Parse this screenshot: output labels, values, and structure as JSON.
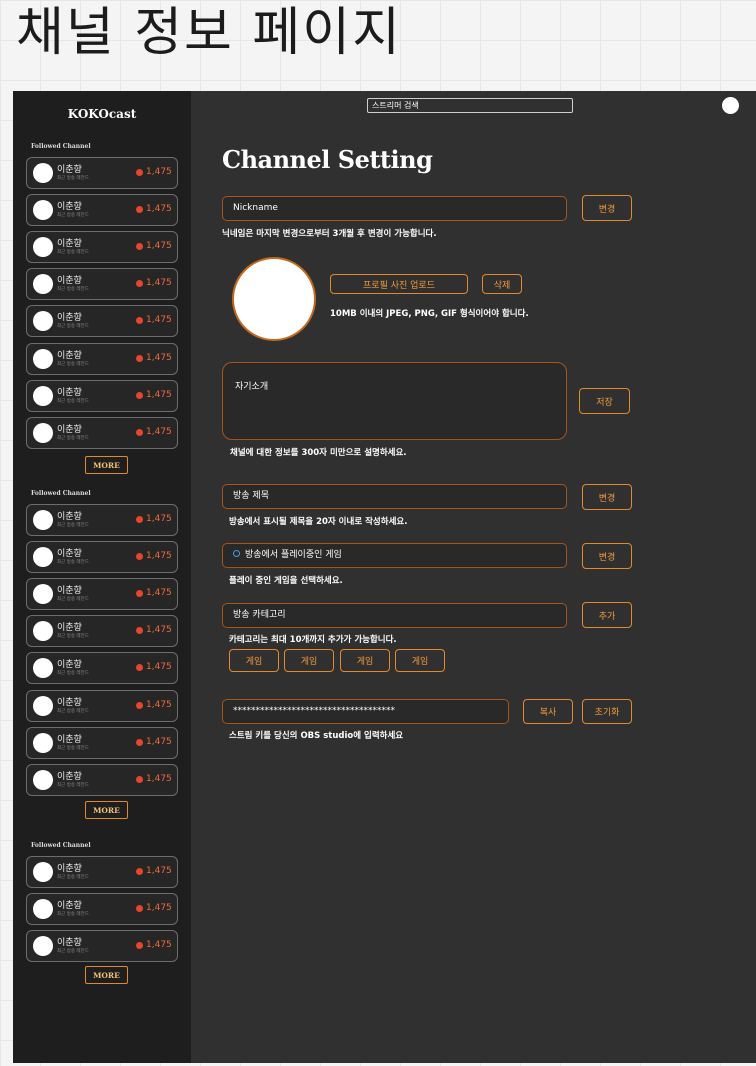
{
  "page_heading": "채널 정보 페이지",
  "sidebar": {
    "logo": "KOKOcast",
    "sections": [
      {
        "title": "Followed Channel",
        "channels": [
          {
            "name": "이춘향",
            "sub": "최근 방송 레전드",
            "viewers": "1,475"
          },
          {
            "name": "이춘향",
            "sub": "최근 방송 레전드",
            "viewers": "1,475"
          },
          {
            "name": "이춘향",
            "sub": "최근 방송 레전드",
            "viewers": "1,475"
          },
          {
            "name": "이춘향",
            "sub": "최근 방송 레전드",
            "viewers": "1,475"
          },
          {
            "name": "이춘향",
            "sub": "최근 방송 레전드",
            "viewers": "1,475"
          },
          {
            "name": "이춘향",
            "sub": "최근 방송 레전드",
            "viewers": "1,475"
          },
          {
            "name": "이춘향",
            "sub": "최근 방송 레전드",
            "viewers": "1,475"
          },
          {
            "name": "이춘향",
            "sub": "최근 방송 레전드",
            "viewers": "1,475"
          }
        ],
        "more_label": "MORE"
      },
      {
        "title": "Followed Channel",
        "channels": [
          {
            "name": "이춘향",
            "sub": "최근 방송 레전드",
            "viewers": "1,475"
          },
          {
            "name": "이춘향",
            "sub": "최근 방송 레전드",
            "viewers": "1,475"
          },
          {
            "name": "이춘향",
            "sub": "최근 방송 레전드",
            "viewers": "1,475"
          },
          {
            "name": "이춘향",
            "sub": "최근 방송 레전드",
            "viewers": "1,475"
          },
          {
            "name": "이춘향",
            "sub": "최근 방송 레전드",
            "viewers": "1,475"
          },
          {
            "name": "이춘향",
            "sub": "최근 방송 레전드",
            "viewers": "1,475"
          },
          {
            "name": "이춘향",
            "sub": "최근 방송 레전드",
            "viewers": "1,475"
          },
          {
            "name": "이춘향",
            "sub": "최근 방송 레전드",
            "viewers": "1,475"
          }
        ],
        "more_label": "MORE"
      },
      {
        "title": "Followed Channel",
        "channels": [
          {
            "name": "이춘향",
            "sub": "최근 방송 레전드",
            "viewers": "1,475"
          },
          {
            "name": "이춘향",
            "sub": "최근 방송 레전드",
            "viewers": "1,475"
          },
          {
            "name": "이춘향",
            "sub": "최근 방송 레전드",
            "viewers": "1,475"
          }
        ],
        "more_label": "MORE"
      }
    ]
  },
  "header": {
    "search_placeholder": "스트리머 검색"
  },
  "main": {
    "title": "Channel Setting",
    "nickname": {
      "value": "Nickname",
      "button": "변경",
      "help": "닉네임은 마지막 변경으로부터 3개월 후 변경이 가능합니다."
    },
    "profile": {
      "upload_button": "프로필 사진 업로드",
      "delete_button": "삭제",
      "help": "10MB 이내의 JPEG, PNG, GIF 형식이어야 합니다."
    },
    "intro": {
      "placeholder": "자기소개",
      "button": "저장",
      "help": "채널에 대한 정보를 300자 미만으로 설명하세요."
    },
    "stream_title": {
      "value": "방송 제목",
      "button": "변경",
      "help": "방송에서 표시될 제목을 20자 이내로 작성하세요."
    },
    "game": {
      "value": "방송에서 플레이중인 게임",
      "button": "변경",
      "help": "플레이 중인 게임을 선택하세요."
    },
    "category": {
      "value": "방송 카테고리",
      "button": "추가",
      "help": "카테고리는 최대 10개까지 추가가 가능합니다.",
      "tags": [
        "게임",
        "게임",
        "게임",
        "게임"
      ]
    },
    "stream_key": {
      "value": "************************************",
      "copy_button": "복사",
      "reset_button": "초기화",
      "help": "스트림 키를 당신의 OBS studio에 입력하세요"
    }
  },
  "colors": {
    "accent": "#e28a2b",
    "live_dot": "#e8452a",
    "sidebar_bg": "#1e1e1e",
    "main_bg": "#303030"
  }
}
